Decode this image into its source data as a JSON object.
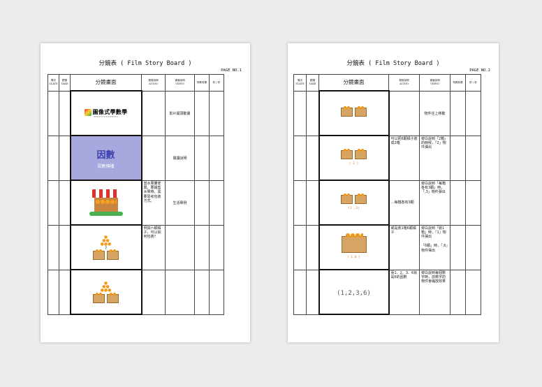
{
  "pages": [
    {
      "title": "分鏡表 ( Film Story Board )",
      "page_no": "PAGE NO.1",
      "headers": {
        "slate": [
          "場次",
          "SLATE"
        ],
        "take": [
          "鏡頭",
          "TAKE"
        ],
        "frame": "分鏡畫面",
        "audio": [
          "聲音說明",
          "AUDIO"
        ],
        "video": [
          "畫面說明",
          "VIDEO"
        ],
        "effects": "特殊效果",
        "seconds": "秒 / 秒"
      },
      "rows": [
        {
          "audio": "",
          "video": "影片開頭動畫",
          "frame": {
            "kind": "logo",
            "logo_text": "圖像式學數學",
            "logo_sub": "INTERACTIVE MATHEMATICS"
          }
        },
        {
          "audio": "",
          "video": "閱讀說明",
          "frame": {
            "kind": "title-card",
            "main": "因數",
            "sub": "因數傳播"
          }
        },
        {
          "audio": "當水果攤老闆，要銷售水果時，需要思考包裝方式。",
          "video": "生活舉例",
          "frame": {
            "kind": "stall"
          }
        },
        {
          "audio": "例如六顆橘子，可以如何包裝？",
          "video": "",
          "frame": {
            "kind": "question",
            "q": "?"
          }
        },
        {
          "audio": "",
          "video": "",
          "frame": {
            "kind": "split"
          }
        }
      ]
    },
    {
      "title": "分鏡表 ( Film Story Board )",
      "page_no": "PAGE NO.2",
      "headers": {
        "slate": [
          "場次",
          "SLATE"
        ],
        "take": [
          "鏡頭",
          "TAKE"
        ],
        "frame": "分鏡畫面",
        "audio": [
          "聲音說明",
          "AUDIO"
        ],
        "video": [
          "畫面說明",
          "VIDEO"
        ],
        "effects": "特殊效果",
        "seconds": "秒 / 秒"
      },
      "rows": [
        {
          "audio": "",
          "video": "物件往上移動",
          "frame": {
            "kind": "two-boxes",
            "caption": ""
          }
        },
        {
          "audio": "可以把6顆橘子裝成2箱",
          "video": "旁白說到「2箱」的時候，「2」物件彈出",
          "frame": {
            "kind": "two-boxes",
            "caption": "( 2 )"
          }
        },
        {
          "audio": "…每箱各有3顆",
          "video": "旁白說到「每箱各有3顆」時，「,3」物件彈出",
          "frame": {
            "kind": "two-boxes",
            "caption": "(2 ,3)"
          }
        },
        {
          "audio": "或是裝1箱6顆橘子",
          "video": "旁白說到「裝1箱」時，「1」物件彈出\n\n「6顆」時，「,6」物件彈出",
          "frame": {
            "kind": "one-box",
            "caption": "( 1,6 )"
          }
        },
        {
          "audio": "而1、2、3、6就是6的因數",
          "video": "旁白說到每個數字時，該數字的物件會縮放效果",
          "frame": {
            "kind": "numbers",
            "caption": "(1,2,3,6)"
          }
        }
      ]
    }
  ]
}
